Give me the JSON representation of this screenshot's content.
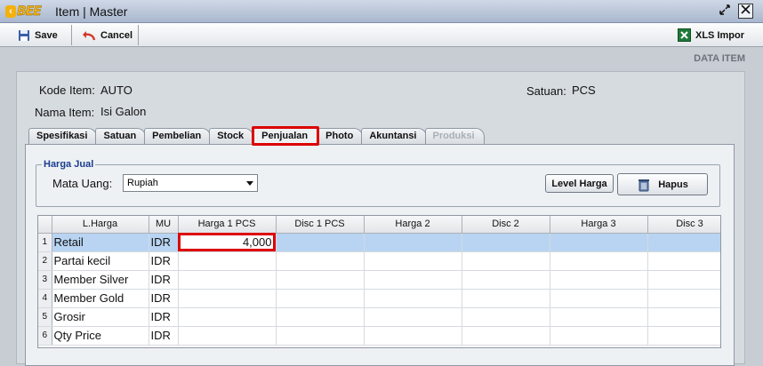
{
  "window": {
    "logo_text": "BEE",
    "title": "Item | Master"
  },
  "toolbar": {
    "save": "Save",
    "cancel": "Cancel",
    "xls_import": "XLS Impor"
  },
  "page_header": "DATA ITEM",
  "form": {
    "kode_item_label": "Kode Item:",
    "kode_item_value": "AUTO",
    "nama_item_label": "Nama Item:",
    "nama_item_value": "Isi Galon",
    "satuan_label": "Satuan:",
    "satuan_value": "PCS"
  },
  "tabs": [
    {
      "label": "Spesifikasi",
      "state": "normal"
    },
    {
      "label": "Satuan",
      "state": "normal"
    },
    {
      "label": "Pembelian",
      "state": "normal"
    },
    {
      "label": "Stock",
      "state": "normal"
    },
    {
      "label": "Penjualan",
      "state": "active"
    },
    {
      "label": "Photo",
      "state": "normal"
    },
    {
      "label": "Akuntansi",
      "state": "normal"
    },
    {
      "label": "Produksi",
      "state": "disabled"
    }
  ],
  "harga_jual": {
    "group_title": "Harga Jual",
    "mata_uang_label": "Mata Uang:",
    "mata_uang_value": "Rupiah",
    "level_harga_button": "Level Harga",
    "hapus_button": "Hapus"
  },
  "grid": {
    "columns": [
      "L.Harga",
      "MU",
      "Harga 1 PCS",
      "Disc 1 PCS",
      "Harga 2",
      "Disc 2",
      "Harga 3",
      "Disc 3"
    ],
    "rows": [
      {
        "no": "1",
        "l_harga": "Retail",
        "mu": "IDR",
        "harga1": "4,000"
      },
      {
        "no": "2",
        "l_harga": "Partai kecil",
        "mu": "IDR",
        "harga1": ""
      },
      {
        "no": "3",
        "l_harga": "Member Silver",
        "mu": "IDR",
        "harga1": ""
      },
      {
        "no": "4",
        "l_harga": "Member Gold",
        "mu": "IDR",
        "harga1": ""
      },
      {
        "no": "5",
        "l_harga": "Grosir",
        "mu": "IDR",
        "harga1": ""
      },
      {
        "no": "6",
        "l_harga": "Qty Price",
        "mu": "IDR",
        "harga1": ""
      }
    ]
  }
}
